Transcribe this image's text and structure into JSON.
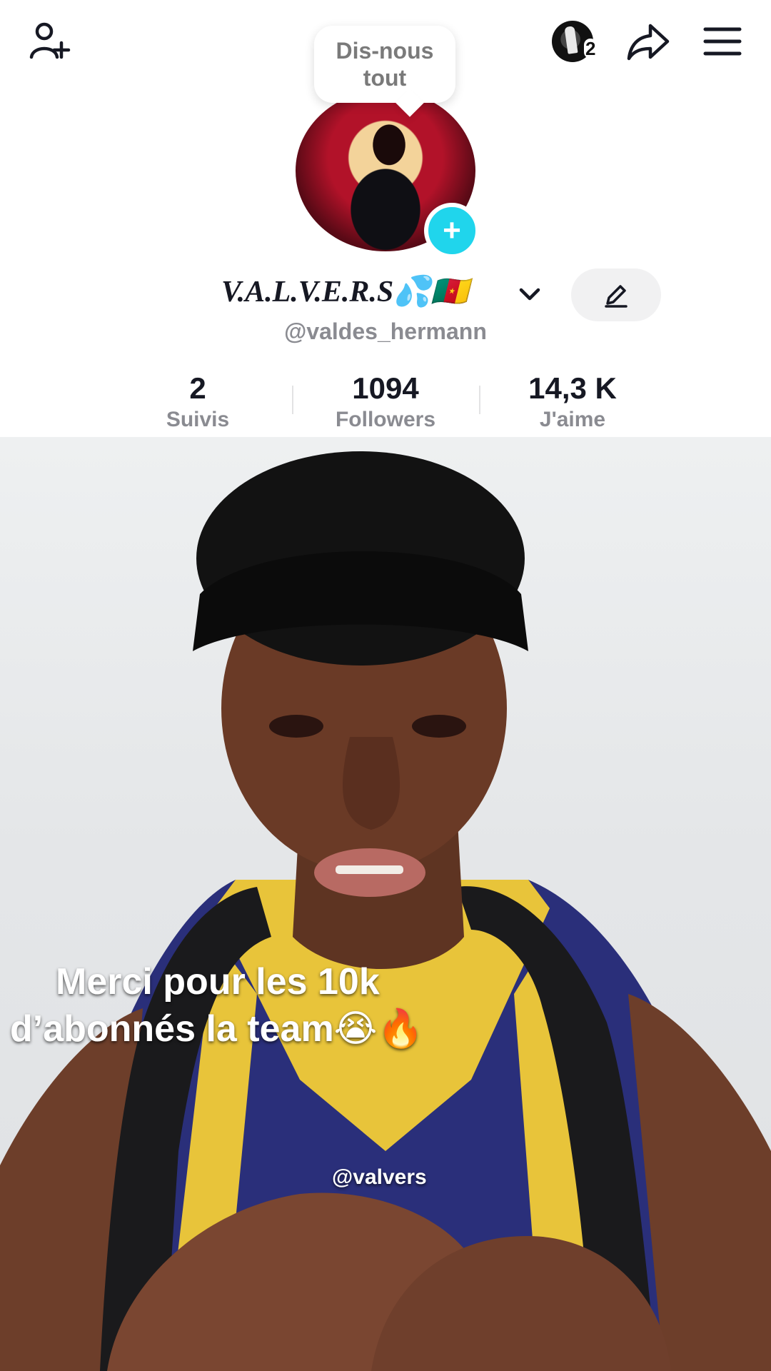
{
  "top_bar": {
    "add_friend_icon": "person-add-icon",
    "notification_count": "2",
    "share_icon": "share-arrow-icon",
    "menu_icon": "hamburger-menu-icon"
  },
  "prompt_bubble": {
    "text": "Dis-nous tout"
  },
  "profile": {
    "display_name": "V.A.L.V.E.R.S💦🇨🇲",
    "username": "@valdes_hermann",
    "accent_color": "#20d5ec"
  },
  "stats": {
    "following": {
      "value": "2",
      "label": "Suivis"
    },
    "followers": {
      "value": "1094",
      "label": "Followers"
    },
    "likes": {
      "value": "14,3 K",
      "label": "J'aime"
    }
  },
  "video": {
    "caption_line1": "Merci pour les 10k",
    "caption_line2": "d’abonnés la team😭🔥",
    "watermark": "@valvers"
  }
}
